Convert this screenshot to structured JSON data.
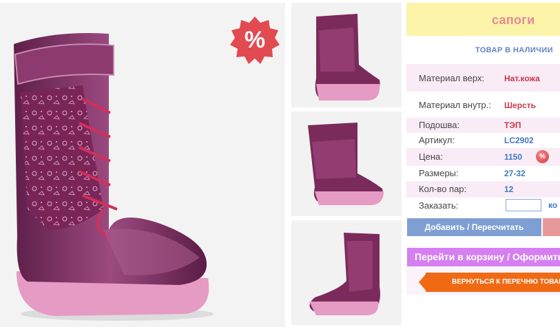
{
  "badge": {
    "sale_symbol": "%"
  },
  "product": {
    "title": "сапоги",
    "stock_status": "ТОВАР В НАЛИЧИИ"
  },
  "specs": {
    "material_top_label": "Материал верх:",
    "material_top_value": "Нат.кожа",
    "material_inner_label": "Материал внутр.:",
    "material_inner_value": "Шерсть",
    "sole_label": "Подошва:",
    "sole_value": "ТЭП",
    "article_label": "Артикул:",
    "article_value": "LC2902",
    "price_label": "Цена:",
    "price_value": "1150",
    "price_badge": "%",
    "sizes_label": "Размеры:",
    "sizes_value": "27-32",
    "pairs_label": "Кол-во пар:",
    "pairs_value": "12",
    "order_label": "Заказать:",
    "order_value": "",
    "order_unit": "ко"
  },
  "buttons": {
    "add": "Добавить / Пересчитать",
    "cart": "Перейти в корзину / Оформить",
    "back": "ВЕРНУТЬСЯ К ПЕРЕЧНЮ ТОВАРОВ"
  },
  "colors": {
    "title_bg": "#fcf4a8",
    "title_text": "#e58a92",
    "row_pink": "#f9ecf7",
    "add_button": "#7f9fd3",
    "cart_button": "#d57ff0",
    "back_button": "#f06a14",
    "boot_purple": "#7b2a5c",
    "sole_pink": "#e59bc3"
  },
  "icons": [
    "percent-badge-icon",
    "back-arrow-icon"
  ]
}
